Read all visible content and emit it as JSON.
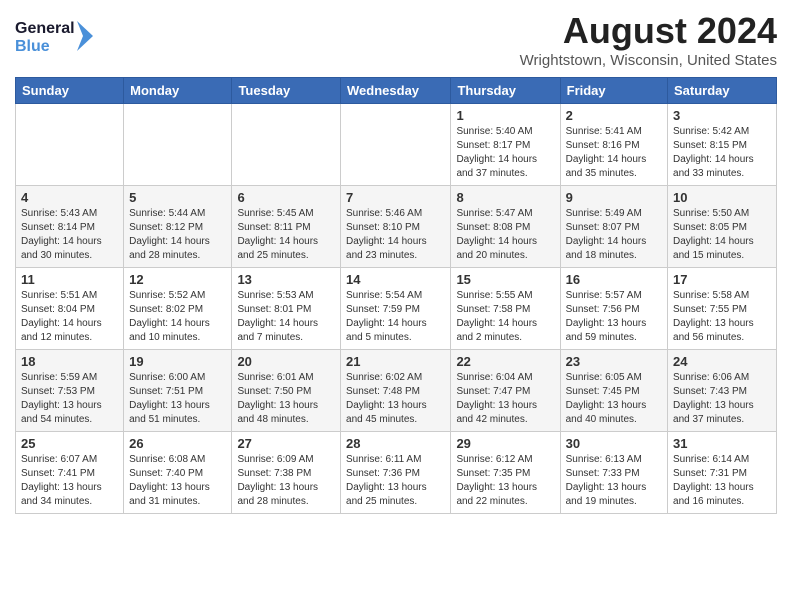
{
  "header": {
    "logo_line1": "General",
    "logo_line2": "Blue",
    "month_year": "August 2024",
    "location": "Wrightstown, Wisconsin, United States"
  },
  "weekdays": [
    "Sunday",
    "Monday",
    "Tuesday",
    "Wednesday",
    "Thursday",
    "Friday",
    "Saturday"
  ],
  "weeks": [
    [
      {
        "day": "",
        "content": ""
      },
      {
        "day": "",
        "content": ""
      },
      {
        "day": "",
        "content": ""
      },
      {
        "day": "",
        "content": ""
      },
      {
        "day": "1",
        "content": "Sunrise: 5:40 AM\nSunset: 8:17 PM\nDaylight: 14 hours\nand 37 minutes."
      },
      {
        "day": "2",
        "content": "Sunrise: 5:41 AM\nSunset: 8:16 PM\nDaylight: 14 hours\nand 35 minutes."
      },
      {
        "day": "3",
        "content": "Sunrise: 5:42 AM\nSunset: 8:15 PM\nDaylight: 14 hours\nand 33 minutes."
      }
    ],
    [
      {
        "day": "4",
        "content": "Sunrise: 5:43 AM\nSunset: 8:14 PM\nDaylight: 14 hours\nand 30 minutes."
      },
      {
        "day": "5",
        "content": "Sunrise: 5:44 AM\nSunset: 8:12 PM\nDaylight: 14 hours\nand 28 minutes."
      },
      {
        "day": "6",
        "content": "Sunrise: 5:45 AM\nSunset: 8:11 PM\nDaylight: 14 hours\nand 25 minutes."
      },
      {
        "day": "7",
        "content": "Sunrise: 5:46 AM\nSunset: 8:10 PM\nDaylight: 14 hours\nand 23 minutes."
      },
      {
        "day": "8",
        "content": "Sunrise: 5:47 AM\nSunset: 8:08 PM\nDaylight: 14 hours\nand 20 minutes."
      },
      {
        "day": "9",
        "content": "Sunrise: 5:49 AM\nSunset: 8:07 PM\nDaylight: 14 hours\nand 18 minutes."
      },
      {
        "day": "10",
        "content": "Sunrise: 5:50 AM\nSunset: 8:05 PM\nDaylight: 14 hours\nand 15 minutes."
      }
    ],
    [
      {
        "day": "11",
        "content": "Sunrise: 5:51 AM\nSunset: 8:04 PM\nDaylight: 14 hours\nand 12 minutes."
      },
      {
        "day": "12",
        "content": "Sunrise: 5:52 AM\nSunset: 8:02 PM\nDaylight: 14 hours\nand 10 minutes."
      },
      {
        "day": "13",
        "content": "Sunrise: 5:53 AM\nSunset: 8:01 PM\nDaylight: 14 hours\nand 7 minutes."
      },
      {
        "day": "14",
        "content": "Sunrise: 5:54 AM\nSunset: 7:59 PM\nDaylight: 14 hours\nand 5 minutes."
      },
      {
        "day": "15",
        "content": "Sunrise: 5:55 AM\nSunset: 7:58 PM\nDaylight: 14 hours\nand 2 minutes."
      },
      {
        "day": "16",
        "content": "Sunrise: 5:57 AM\nSunset: 7:56 PM\nDaylight: 13 hours\nand 59 minutes."
      },
      {
        "day": "17",
        "content": "Sunrise: 5:58 AM\nSunset: 7:55 PM\nDaylight: 13 hours\nand 56 minutes."
      }
    ],
    [
      {
        "day": "18",
        "content": "Sunrise: 5:59 AM\nSunset: 7:53 PM\nDaylight: 13 hours\nand 54 minutes."
      },
      {
        "day": "19",
        "content": "Sunrise: 6:00 AM\nSunset: 7:51 PM\nDaylight: 13 hours\nand 51 minutes."
      },
      {
        "day": "20",
        "content": "Sunrise: 6:01 AM\nSunset: 7:50 PM\nDaylight: 13 hours\nand 48 minutes."
      },
      {
        "day": "21",
        "content": "Sunrise: 6:02 AM\nSunset: 7:48 PM\nDaylight: 13 hours\nand 45 minutes."
      },
      {
        "day": "22",
        "content": "Sunrise: 6:04 AM\nSunset: 7:47 PM\nDaylight: 13 hours\nand 42 minutes."
      },
      {
        "day": "23",
        "content": "Sunrise: 6:05 AM\nSunset: 7:45 PM\nDaylight: 13 hours\nand 40 minutes."
      },
      {
        "day": "24",
        "content": "Sunrise: 6:06 AM\nSunset: 7:43 PM\nDaylight: 13 hours\nand 37 minutes."
      }
    ],
    [
      {
        "day": "25",
        "content": "Sunrise: 6:07 AM\nSunset: 7:41 PM\nDaylight: 13 hours\nand 34 minutes."
      },
      {
        "day": "26",
        "content": "Sunrise: 6:08 AM\nSunset: 7:40 PM\nDaylight: 13 hours\nand 31 minutes."
      },
      {
        "day": "27",
        "content": "Sunrise: 6:09 AM\nSunset: 7:38 PM\nDaylight: 13 hours\nand 28 minutes."
      },
      {
        "day": "28",
        "content": "Sunrise: 6:11 AM\nSunset: 7:36 PM\nDaylight: 13 hours\nand 25 minutes."
      },
      {
        "day": "29",
        "content": "Sunrise: 6:12 AM\nSunset: 7:35 PM\nDaylight: 13 hours\nand 22 minutes."
      },
      {
        "day": "30",
        "content": "Sunrise: 6:13 AM\nSunset: 7:33 PM\nDaylight: 13 hours\nand 19 minutes."
      },
      {
        "day": "31",
        "content": "Sunrise: 6:14 AM\nSunset: 7:31 PM\nDaylight: 13 hours\nand 16 minutes."
      }
    ]
  ]
}
